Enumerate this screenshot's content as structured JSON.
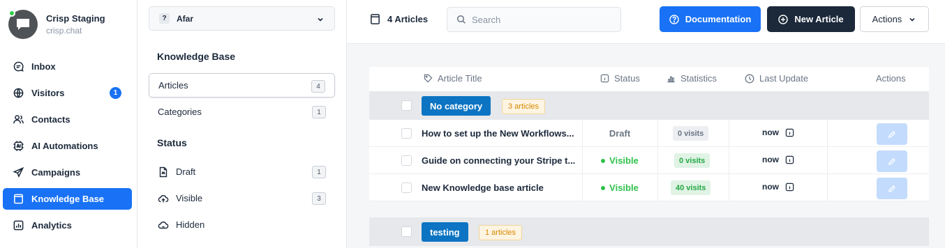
{
  "workspace": {
    "name": "Crisp Staging",
    "domain": "crisp.chat"
  },
  "nav": [
    {
      "label": "Inbox",
      "icon": "inbox-icon"
    },
    {
      "label": "Visitors",
      "icon": "globe-icon",
      "badge": "1"
    },
    {
      "label": "Contacts",
      "icon": "contacts-icon"
    },
    {
      "label": "AI Automations",
      "icon": "ai-icon"
    },
    {
      "label": "Campaigns",
      "icon": "send-icon"
    },
    {
      "label": "Knowledge Base",
      "icon": "book-icon",
      "active": true
    },
    {
      "label": "Analytics",
      "icon": "chart-icon"
    }
  ],
  "panel": {
    "language": "Afar",
    "language_icon": "?",
    "kb_title": "Knowledge Base",
    "kb_items": [
      {
        "label": "Articles",
        "count": "4"
      },
      {
        "label": "Categories",
        "count": "1"
      }
    ],
    "status_title": "Status",
    "status_items": [
      {
        "label": "Draft",
        "count": "1"
      },
      {
        "label": "Visible",
        "count": "3"
      },
      {
        "label": "Hidden",
        "count": ""
      }
    ]
  },
  "topbar": {
    "articles_count": "4 Articles",
    "search_placeholder": "Search",
    "doc_button": "Documentation",
    "new_button": "New Article",
    "actions_button": "Actions"
  },
  "table": {
    "headers": {
      "title": "Article Title",
      "status": "Status",
      "stats": "Statistics",
      "updated": "Last Update",
      "actions": "Actions"
    },
    "groups": [
      {
        "name": "No category",
        "count": "3 articles",
        "rows": [
          {
            "title": "How to set up the New Workflows...",
            "status": "Draft",
            "visits": "0 visits",
            "updated": "now"
          },
          {
            "title": "Guide on connecting your Stripe t...",
            "status": "Visible",
            "visits": "0 visits",
            "updated": "now"
          },
          {
            "title": "New Knowledge base article",
            "status": "Visible",
            "visits": "40 visits",
            "updated": "now"
          }
        ]
      },
      {
        "name": "testing",
        "count": "1 articles",
        "rows": []
      }
    ]
  },
  "colors": {
    "accent": "#1972f5",
    "dark": "#1c293b",
    "visible": "#2ec14b",
    "category": "#0c74c2"
  }
}
